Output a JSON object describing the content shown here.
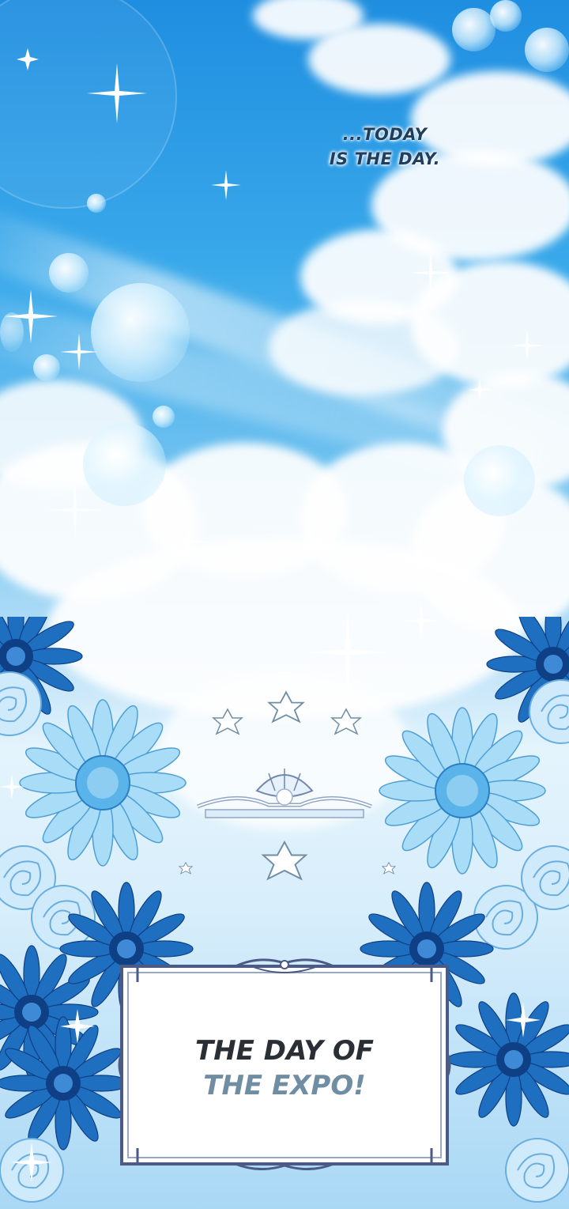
{
  "caption": {
    "line1": "...TODAY",
    "line2": "IS THE DAY."
  },
  "title_card": {
    "line1": "THE DAY OF",
    "line2": "THE EXPO!"
  },
  "colors": {
    "sky_top": "#1f8ee0",
    "sky_light": "#e4f4fd",
    "flower_light": "#a8dcf7",
    "flower_mid": "#5ab4ea",
    "flower_dark": "#1a5fb0",
    "frame_border": "#4c5a86",
    "title_dark": "#2a2f36",
    "title_light": "#6f8da3"
  },
  "icons": [
    "sparkle-icon",
    "star-icon",
    "shell-pearl-icon",
    "daisy-flower-icon",
    "rose-flower-icon",
    "bubble-icon"
  ]
}
